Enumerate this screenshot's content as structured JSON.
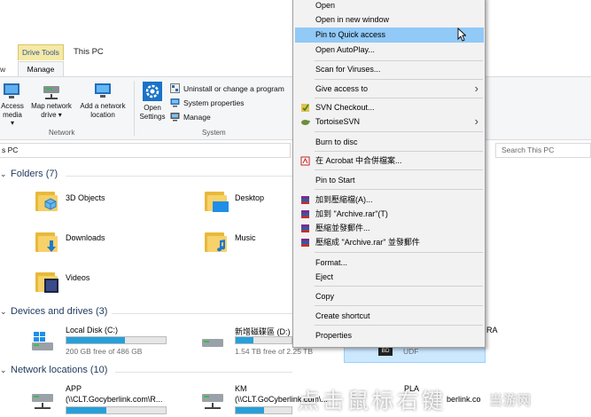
{
  "ribbon": {
    "drive_tools_tab": "Drive Tools",
    "window_title": "This PC",
    "manage_tab": "Manage",
    "view_tab": "w",
    "buttons": {
      "access_media_1": "Access",
      "access_media_2": "media ▾",
      "map_drive_1": "Map network",
      "map_drive_2": "drive ▾",
      "add_location_1": "Add a network",
      "add_location_2": "location",
      "open_settings_1": "Open",
      "open_settings_2": "Settings",
      "uninstall": "Uninstall or change a program",
      "system_properties": "System properties",
      "manage": "Manage"
    },
    "groups": {
      "network": "Network",
      "system": "System"
    }
  },
  "address": {
    "path": "s PC",
    "search_placeholder": "Search This PC"
  },
  "sections": {
    "folders": "Folders (7)",
    "devices": "Devices and drives (3)",
    "network": "Network locations (10)"
  },
  "folders": [
    "3D Objects",
    "Desktop",
    "Downloads",
    "Music",
    "Videos"
  ],
  "drives": {
    "c": {
      "name": "Local Disk (C:)",
      "free": "200 GB free of 486 GB",
      "used_fraction": 0.59
    },
    "d": {
      "name": "新增磁碟區 (D:)",
      "free": "1.54 TB free of 2.25 TB",
      "used_fraction": 0.32
    },
    "bd": {
      "name": "RA",
      "badge": "BD",
      "fs": "UDF"
    }
  },
  "network_locations": {
    "app": {
      "name": "APP",
      "path": "(\\\\CLT.Gocyberlink.com\\R..."
    },
    "km": {
      "name": "KM",
      "path": "(\\\\CLT.GoCyberlink.com\\..."
    },
    "third": {
      "name": "PLA",
      "path": "berlink.co"
    }
  },
  "context_menu": {
    "open": "Open",
    "open_new_window": "Open in new window",
    "pin_quick_access": "Pin to Quick access",
    "open_autoplay": "Open AutoPlay...",
    "scan_viruses": "Scan for Viruses...",
    "give_access": "Give access to",
    "svn_checkout": "SVN Checkout...",
    "tortoise_svn": "TortoiseSVN",
    "burn_disc": "Burn to disc",
    "acrobat_merge": "在 Acrobat 中合併檔案...",
    "pin_start": "Pin to Start",
    "add_archive": "加到壓縮檔(A)...",
    "add_archive_rar": "加到 \"Archive.rar\"(T)",
    "compress_email": "壓縮並發郵件...",
    "compress_rar_email": "壓縮成 \"Archive.rar\" 並發郵件",
    "format": "Format...",
    "eject": "Eject",
    "copy": "Copy",
    "create_shortcut": "Create shortcut",
    "properties": "Properties"
  },
  "watermark": {
    "text": "点击鼠标右键",
    "brand": "当游网"
  },
  "colors": {
    "highlight": "#91c9f7",
    "drive_fill": "#26a0da",
    "selection": "#cce8ff",
    "tool_tab": "#f6e9a5"
  }
}
